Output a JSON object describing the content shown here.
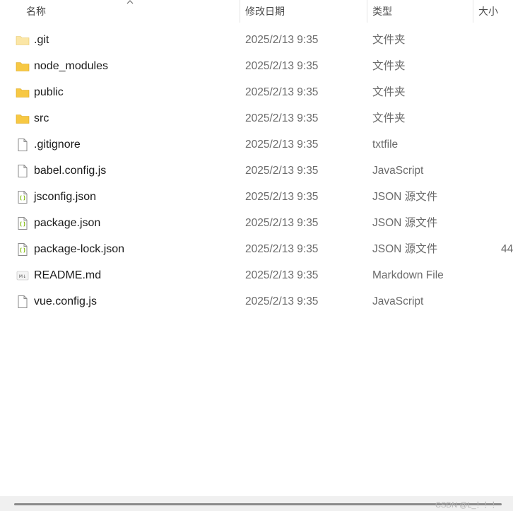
{
  "columns": {
    "name": "名称",
    "date": "修改日期",
    "type": "类型",
    "size": "大小"
  },
  "files": [
    {
      "name": ".git",
      "date": "2025/2/13 9:35",
      "type": "文件夹",
      "size": "",
      "icon": "folder-light"
    },
    {
      "name": "node_modules",
      "date": "2025/2/13 9:35",
      "type": "文件夹",
      "size": "",
      "icon": "folder"
    },
    {
      "name": "public",
      "date": "2025/2/13 9:35",
      "type": "文件夹",
      "size": "",
      "icon": "folder"
    },
    {
      "name": "src",
      "date": "2025/2/13 9:35",
      "type": "文件夹",
      "size": "",
      "icon": "folder"
    },
    {
      "name": ".gitignore",
      "date": "2025/2/13 9:35",
      "type": "txtfile",
      "size": "",
      "icon": "file"
    },
    {
      "name": "babel.config.js",
      "date": "2025/2/13 9:35",
      "type": "JavaScript",
      "size": "",
      "icon": "file"
    },
    {
      "name": "jsconfig.json",
      "date": "2025/2/13 9:35",
      "type": "JSON 源文件",
      "size": "",
      "icon": "json"
    },
    {
      "name": "package.json",
      "date": "2025/2/13 9:35",
      "type": "JSON 源文件",
      "size": "",
      "icon": "json"
    },
    {
      "name": "package-lock.json",
      "date": "2025/2/13 9:35",
      "type": "JSON 源文件",
      "size": "44",
      "icon": "json"
    },
    {
      "name": "README.md",
      "date": "2025/2/13 9:35",
      "type": "Markdown File",
      "size": "",
      "icon": "markdown"
    },
    {
      "name": "vue.config.js",
      "date": "2025/2/13 9:35",
      "type": "JavaScript",
      "size": "",
      "icon": "file"
    }
  ],
  "watermark": "CSDN @L_！！！",
  "colors": {
    "folder": "#f7c843",
    "folder_light": "#fbe6a6",
    "json_brace": "#7ab800"
  }
}
